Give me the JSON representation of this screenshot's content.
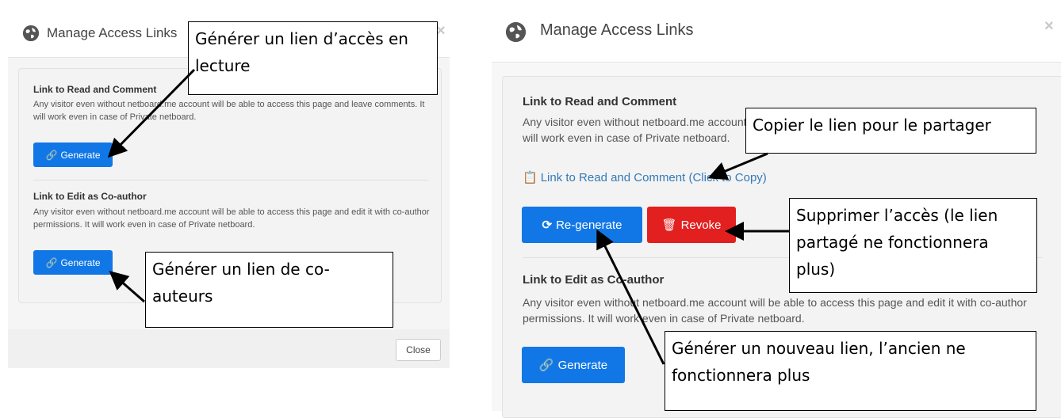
{
  "left_modal": {
    "title": "Manage Access Links",
    "close_x": "×",
    "read_section": {
      "title": "Link to Read and Comment",
      "description": "Any visitor even without netboard.me account will be able to access this page and leave comments. It will work even in case of Private netboard.",
      "generate_label": "Generate"
    },
    "edit_section": {
      "title": "Link to Edit as Co-author",
      "description": "Any visitor even without netboard.me account will be able to access this page and edit it with co-author permissions. It will work even in case of Private netboard.",
      "generate_label": "Generate"
    },
    "footer": {
      "close_label": "Close"
    }
  },
  "right_modal": {
    "title": "Manage Access Links",
    "close_x": "×",
    "read_section": {
      "title": "Link to Read and Comment",
      "description": "Any visitor even without netboard.me account will be able to access this page and leave comments. It will work even in case of Private netboard.",
      "copy_link_label": "Link to Read and Comment (Click to Copy)",
      "regenerate_label": "Re-generate",
      "revoke_label": "Revoke"
    },
    "edit_section": {
      "title": "Link to Edit as Co-author",
      "description": "Any visitor even without netboard.me account will be able to access this page and edit it with co-author permissions. It will work even in case of Private netboard.",
      "generate_label": "Generate"
    }
  },
  "callouts": {
    "generate_read": "Générer un lien d’accès en lecture",
    "generate_coauthor": "Générer un lien de co-auteurs",
    "copy_link": "Copier le lien pour le partager",
    "revoke": "Supprimer l’accès (le lien partagé ne fonctionnera plus)",
    "regenerate": "Générer un nouveau lien, l’ancien ne fonctionnera plus"
  },
  "colors": {
    "primary": "#1177e6",
    "danger": "#e32020",
    "link": "#337ab7"
  },
  "icons": [
    "globe-icon",
    "link-icon",
    "refresh-icon",
    "trash-icon",
    "copy-icon",
    "close-icon"
  ]
}
